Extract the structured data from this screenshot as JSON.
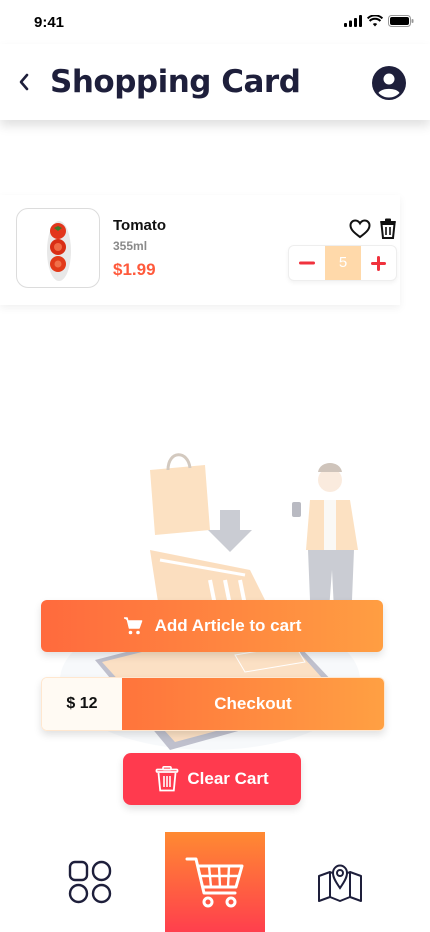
{
  "status_bar": {
    "time": "9:41"
  },
  "header": {
    "title": "Shopping Card"
  },
  "cart_item": {
    "name": "Tomato",
    "size": "355ml",
    "price": "$1.99",
    "quantity": "5"
  },
  "actions": {
    "add_label": "Add Article to cart",
    "total": "$ 12",
    "checkout_label": "Checkout",
    "clear_label": "Clear Cart"
  },
  "colors": {
    "accent_orange": "#ff6a3d",
    "accent_light_orange": "#ff9e42",
    "price_red": "#ff5a3c",
    "clear_red": "#ff3a4e",
    "title_navy": "#1e1f3b"
  },
  "icons": {
    "back": "chevron-left-icon",
    "profile": "user-circle-icon",
    "favorite": "heart-icon",
    "delete": "trash-icon",
    "minus": "minus-icon",
    "plus": "plus-icon",
    "add_cart": "cart-icon",
    "clear": "trash-icon",
    "nav_home": "grid-icon",
    "nav_cart": "shopping-cart-icon",
    "nav_map": "map-icon"
  }
}
